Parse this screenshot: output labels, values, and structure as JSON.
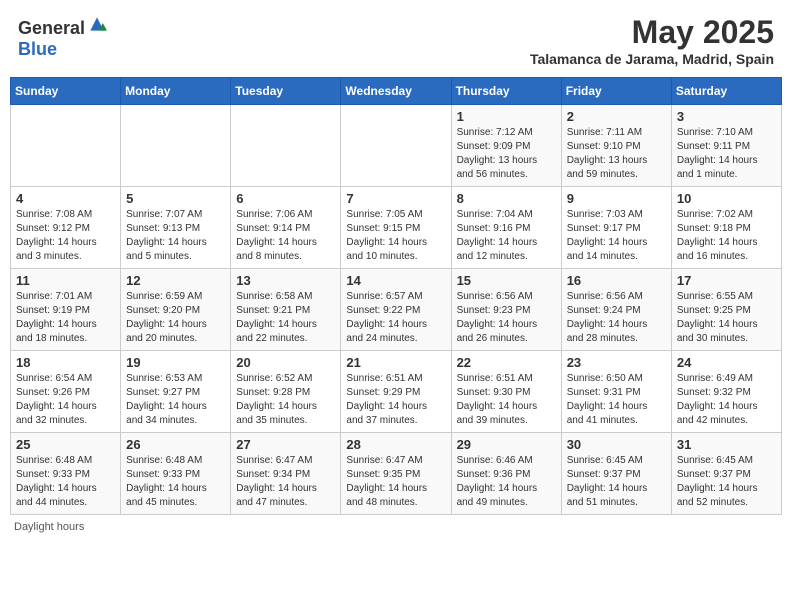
{
  "header": {
    "logo_general": "General",
    "logo_blue": "Blue",
    "month": "May 2025",
    "location": "Talamanca de Jarama, Madrid, Spain"
  },
  "days_of_week": [
    "Sunday",
    "Monday",
    "Tuesday",
    "Wednesday",
    "Thursday",
    "Friday",
    "Saturday"
  ],
  "footer": "Daylight hours",
  "weeks": [
    [
      {
        "day": "",
        "content": ""
      },
      {
        "day": "",
        "content": ""
      },
      {
        "day": "",
        "content": ""
      },
      {
        "day": "",
        "content": ""
      },
      {
        "day": "1",
        "content": "Sunrise: 7:12 AM\nSunset: 9:09 PM\nDaylight: 13 hours and 56 minutes."
      },
      {
        "day": "2",
        "content": "Sunrise: 7:11 AM\nSunset: 9:10 PM\nDaylight: 13 hours and 59 minutes."
      },
      {
        "day": "3",
        "content": "Sunrise: 7:10 AM\nSunset: 9:11 PM\nDaylight: 14 hours and 1 minute."
      }
    ],
    [
      {
        "day": "4",
        "content": "Sunrise: 7:08 AM\nSunset: 9:12 PM\nDaylight: 14 hours and 3 minutes."
      },
      {
        "day": "5",
        "content": "Sunrise: 7:07 AM\nSunset: 9:13 PM\nDaylight: 14 hours and 5 minutes."
      },
      {
        "day": "6",
        "content": "Sunrise: 7:06 AM\nSunset: 9:14 PM\nDaylight: 14 hours and 8 minutes."
      },
      {
        "day": "7",
        "content": "Sunrise: 7:05 AM\nSunset: 9:15 PM\nDaylight: 14 hours and 10 minutes."
      },
      {
        "day": "8",
        "content": "Sunrise: 7:04 AM\nSunset: 9:16 PM\nDaylight: 14 hours and 12 minutes."
      },
      {
        "day": "9",
        "content": "Sunrise: 7:03 AM\nSunset: 9:17 PM\nDaylight: 14 hours and 14 minutes."
      },
      {
        "day": "10",
        "content": "Sunrise: 7:02 AM\nSunset: 9:18 PM\nDaylight: 14 hours and 16 minutes."
      }
    ],
    [
      {
        "day": "11",
        "content": "Sunrise: 7:01 AM\nSunset: 9:19 PM\nDaylight: 14 hours and 18 minutes."
      },
      {
        "day": "12",
        "content": "Sunrise: 6:59 AM\nSunset: 9:20 PM\nDaylight: 14 hours and 20 minutes."
      },
      {
        "day": "13",
        "content": "Sunrise: 6:58 AM\nSunset: 9:21 PM\nDaylight: 14 hours and 22 minutes."
      },
      {
        "day": "14",
        "content": "Sunrise: 6:57 AM\nSunset: 9:22 PM\nDaylight: 14 hours and 24 minutes."
      },
      {
        "day": "15",
        "content": "Sunrise: 6:56 AM\nSunset: 9:23 PM\nDaylight: 14 hours and 26 minutes."
      },
      {
        "day": "16",
        "content": "Sunrise: 6:56 AM\nSunset: 9:24 PM\nDaylight: 14 hours and 28 minutes."
      },
      {
        "day": "17",
        "content": "Sunrise: 6:55 AM\nSunset: 9:25 PM\nDaylight: 14 hours and 30 minutes."
      }
    ],
    [
      {
        "day": "18",
        "content": "Sunrise: 6:54 AM\nSunset: 9:26 PM\nDaylight: 14 hours and 32 minutes."
      },
      {
        "day": "19",
        "content": "Sunrise: 6:53 AM\nSunset: 9:27 PM\nDaylight: 14 hours and 34 minutes."
      },
      {
        "day": "20",
        "content": "Sunrise: 6:52 AM\nSunset: 9:28 PM\nDaylight: 14 hours and 35 minutes."
      },
      {
        "day": "21",
        "content": "Sunrise: 6:51 AM\nSunset: 9:29 PM\nDaylight: 14 hours and 37 minutes."
      },
      {
        "day": "22",
        "content": "Sunrise: 6:51 AM\nSunset: 9:30 PM\nDaylight: 14 hours and 39 minutes."
      },
      {
        "day": "23",
        "content": "Sunrise: 6:50 AM\nSunset: 9:31 PM\nDaylight: 14 hours and 41 minutes."
      },
      {
        "day": "24",
        "content": "Sunrise: 6:49 AM\nSunset: 9:32 PM\nDaylight: 14 hours and 42 minutes."
      }
    ],
    [
      {
        "day": "25",
        "content": "Sunrise: 6:48 AM\nSunset: 9:33 PM\nDaylight: 14 hours and 44 minutes."
      },
      {
        "day": "26",
        "content": "Sunrise: 6:48 AM\nSunset: 9:33 PM\nDaylight: 14 hours and 45 minutes."
      },
      {
        "day": "27",
        "content": "Sunrise: 6:47 AM\nSunset: 9:34 PM\nDaylight: 14 hours and 47 minutes."
      },
      {
        "day": "28",
        "content": "Sunrise: 6:47 AM\nSunset: 9:35 PM\nDaylight: 14 hours and 48 minutes."
      },
      {
        "day": "29",
        "content": "Sunrise: 6:46 AM\nSunset: 9:36 PM\nDaylight: 14 hours and 49 minutes."
      },
      {
        "day": "30",
        "content": "Sunrise: 6:45 AM\nSunset: 9:37 PM\nDaylight: 14 hours and 51 minutes."
      },
      {
        "day": "31",
        "content": "Sunrise: 6:45 AM\nSunset: 9:37 PM\nDaylight: 14 hours and 52 minutes."
      }
    ]
  ]
}
